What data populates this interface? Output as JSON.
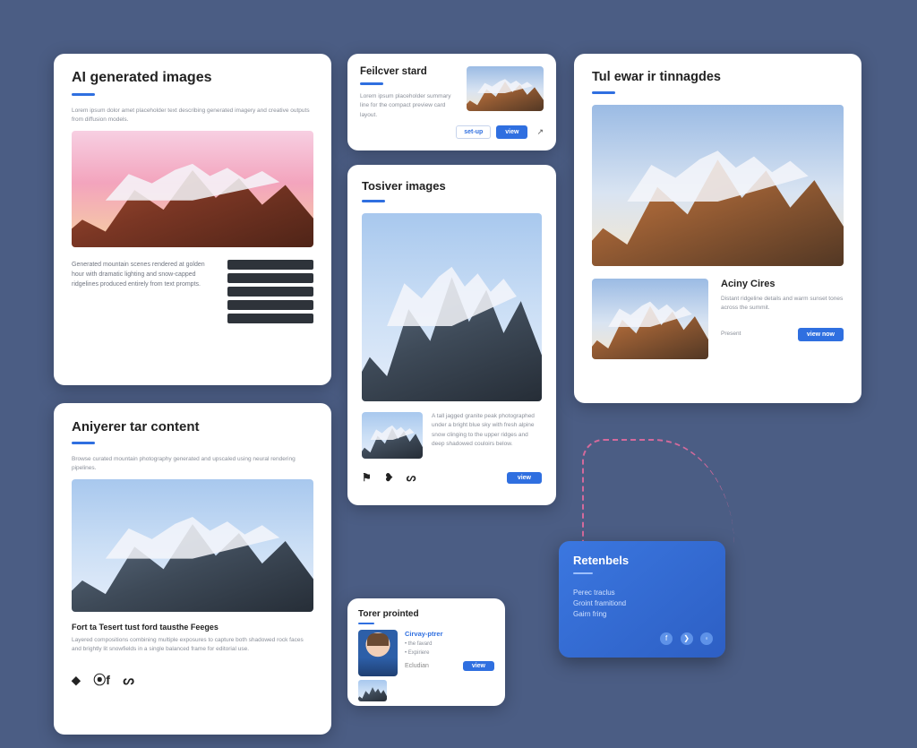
{
  "card1": {
    "title": "AI generated images",
    "intro": "Lorem ipsum dolor amet placeholder text describing generated imagery and creative outputs from diffusion models.",
    "para": "Generated mountain scenes rendered at golden hour with dramatic lighting and snow-capped ridgelines produced entirely from text prompts."
  },
  "card2": {
    "title": "Feilcver stard",
    "btn_outline": "set-up",
    "btn": "view"
  },
  "card3": {
    "title": "Tosiver images",
    "caption": "A tall jagged granite peak photographed under a bright blue sky with fresh alpine snow clinging to the upper ridges and deep shadowed couloirs below.",
    "btn": "view"
  },
  "card4": {
    "title": "Tul ewar ir tinnagdes",
    "side_title": "Aciny Cires",
    "side_text": "Distant ridgeline details and warm sunset tones across the summit.",
    "label": "Present",
    "btn": "view now"
  },
  "card5": {
    "title": "Aniyerer tar content",
    "intro": "Browse curated mountain photography generated and upscaled using neural rendering pipelines.",
    "subtitle": "Fort ta Tesert tust ford tausthe Feeges",
    "para": "Layered compositions combining multiple exposures to capture both shadowed rock faces and brightly lit snowfields in a single balanced frame for editorial use."
  },
  "card6": {
    "title": "Torer prointed",
    "name": "Cirvay-ptrer",
    "item1": "• the favard",
    "item2": "• Expiriere",
    "label": "Ecludian",
    "btn": "view"
  },
  "card7": {
    "title": "Retenbels",
    "line1": "Perec traclus",
    "line2": "Groint framitiond",
    "line3": "Gairn fring"
  }
}
